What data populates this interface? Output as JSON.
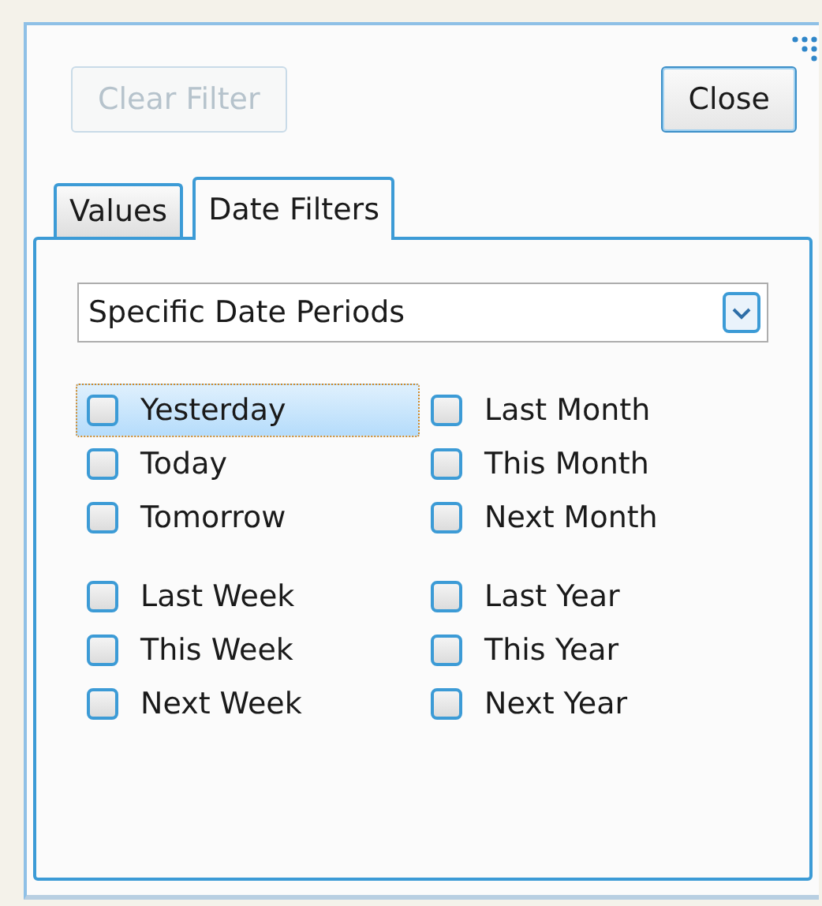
{
  "buttons": {
    "clear_filter": {
      "label": "Clear Filter",
      "disabled": true
    },
    "close": {
      "label": "Close",
      "disabled": false
    }
  },
  "tabs": [
    {
      "label": "Values",
      "selected": false
    },
    {
      "label": "Date Filters",
      "selected": true
    }
  ],
  "dropdown": {
    "value": "Specific Date Periods"
  },
  "groups": [
    {
      "left": [
        {
          "label": "Yesterday",
          "checked": false,
          "selected": true
        },
        {
          "label": "Today",
          "checked": false,
          "selected": false
        },
        {
          "label": "Tomorrow",
          "checked": false,
          "selected": false
        }
      ],
      "right": [
        {
          "label": "Last Month",
          "checked": false,
          "selected": false
        },
        {
          "label": "This Month",
          "checked": false,
          "selected": false
        },
        {
          "label": "Next Month",
          "checked": false,
          "selected": false
        }
      ]
    },
    {
      "left": [
        {
          "label": "Last Week",
          "checked": false,
          "selected": false
        },
        {
          "label": "This Week",
          "checked": false,
          "selected": false
        },
        {
          "label": "Next Week",
          "checked": false,
          "selected": false
        }
      ],
      "right": [
        {
          "label": "Last Year",
          "checked": false,
          "selected": false
        },
        {
          "label": "This Year",
          "checked": false,
          "selected": false
        },
        {
          "label": "Next Year",
          "checked": false,
          "selected": false
        }
      ]
    }
  ]
}
